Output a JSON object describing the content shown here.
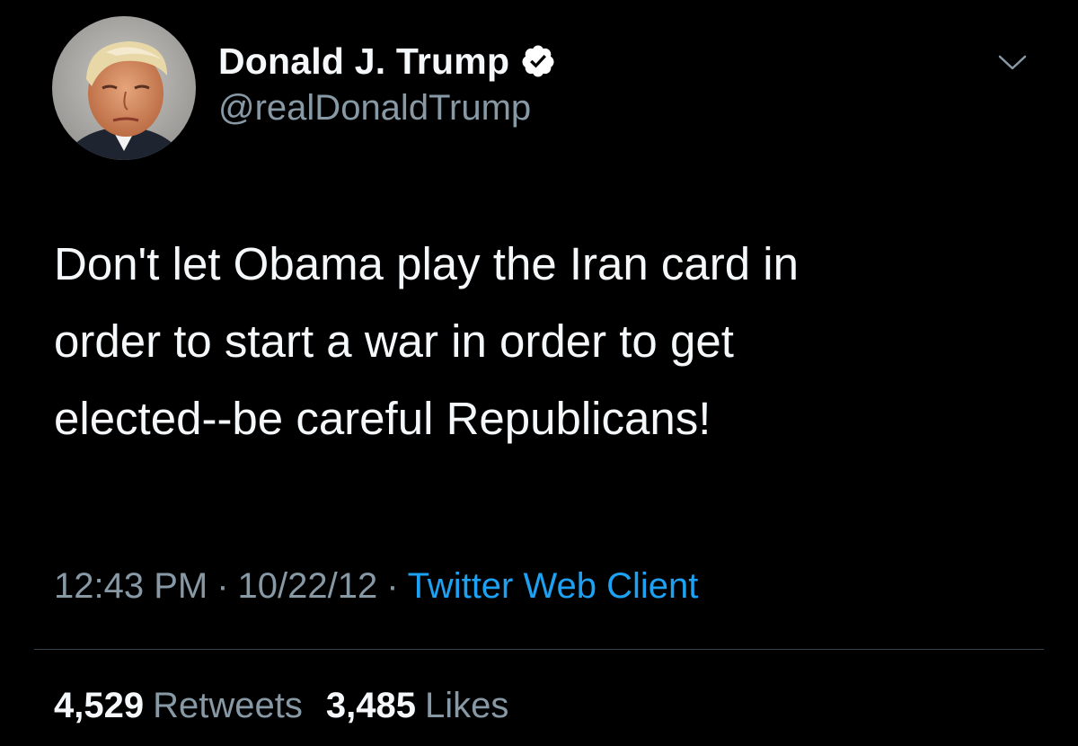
{
  "tweet": {
    "author": {
      "display_name": "Donald J. Trump",
      "handle": "@realDonaldTrump",
      "verified": true,
      "avatar_icon": "profile-photo"
    },
    "menu_icon": "chevron-down-icon",
    "text_lines": [
      "Don't let Obama play the Iran card in",
      "order to start a war in order to get",
      "elected--be careful Republicans!"
    ],
    "time": "12:43 PM",
    "date": "10/22/12",
    "separator": "·",
    "source": "Twitter Web Client",
    "stats": {
      "retweets_count": "4,529",
      "retweets_label": "Retweets",
      "likes_count": "3,485",
      "likes_label": "Likes"
    }
  },
  "colors": {
    "background": "#000000",
    "primary_text": "#f5f8fa",
    "secondary_text": "#8899a6",
    "link": "#1da1f2",
    "divider": "#38444d"
  }
}
